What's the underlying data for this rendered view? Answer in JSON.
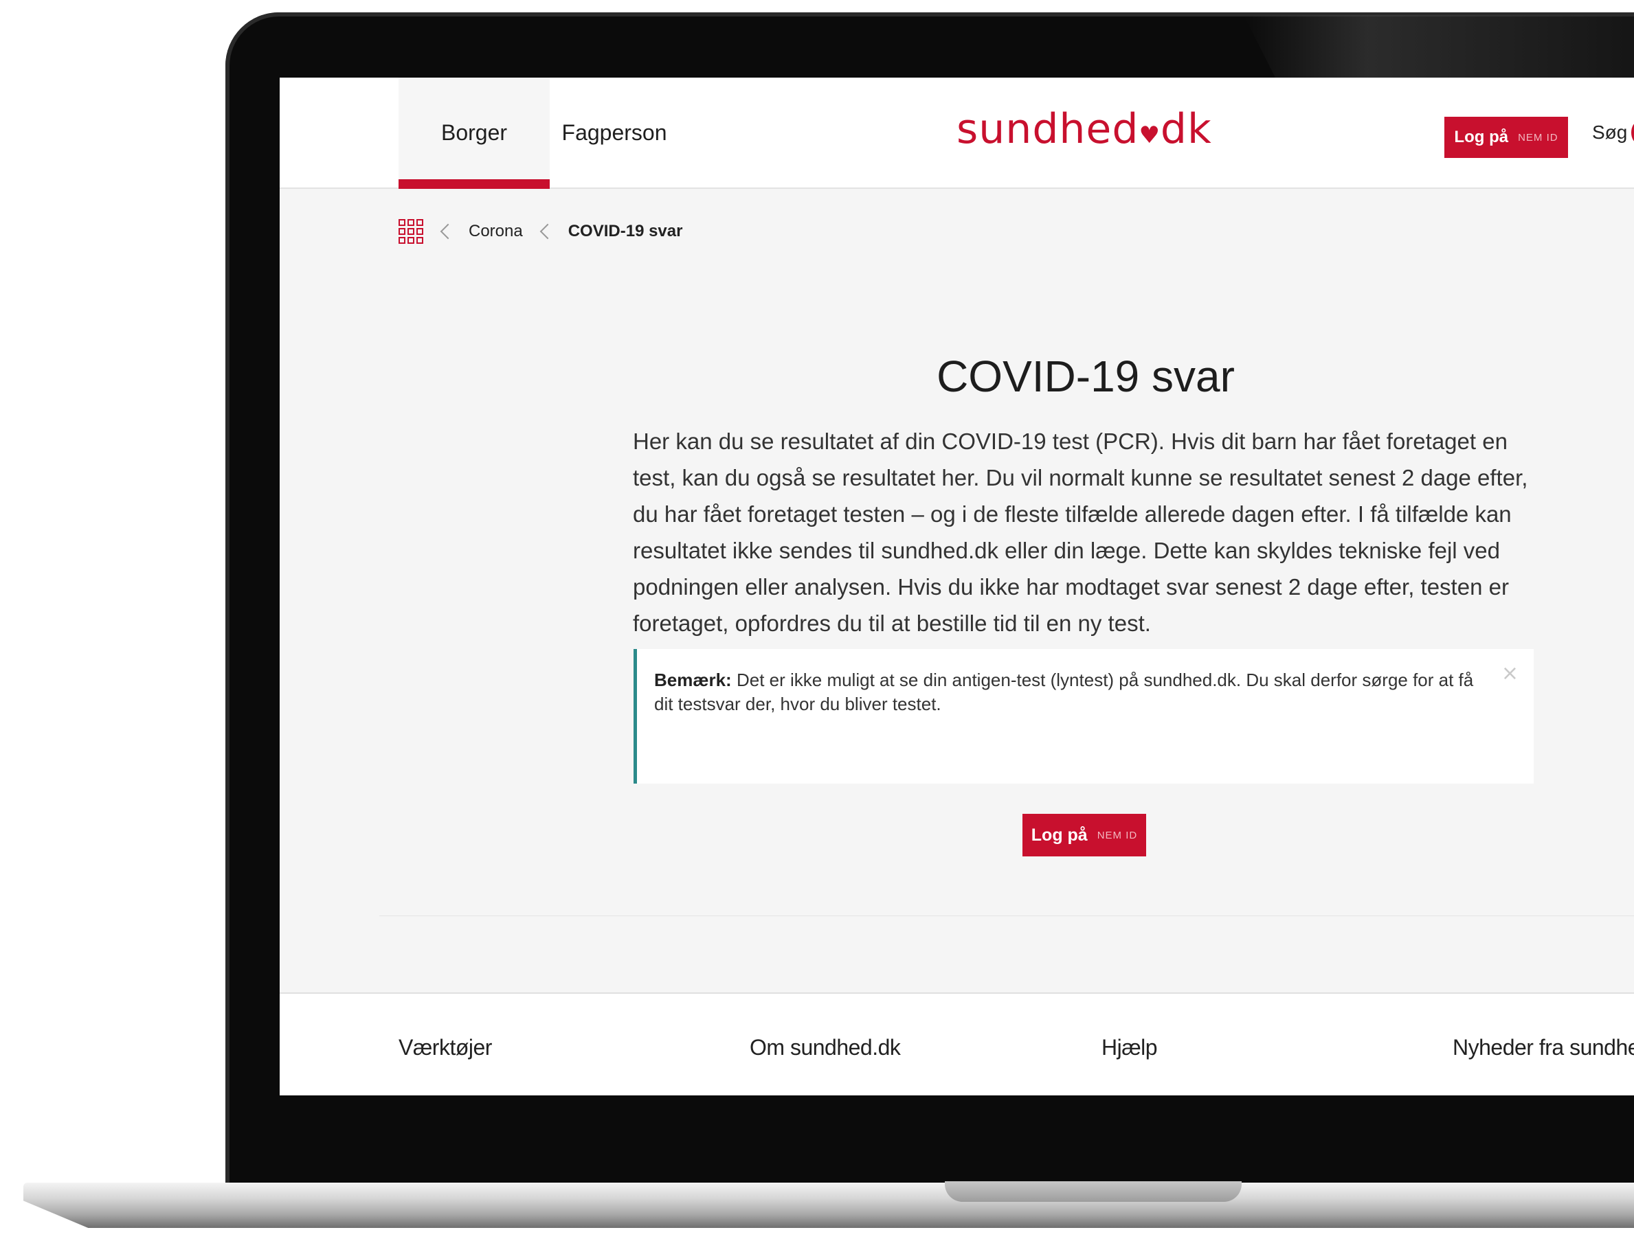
{
  "header": {
    "tabs": [
      {
        "label": "Borger",
        "active": true
      },
      {
        "label": "Fagperson",
        "active": false
      }
    ],
    "logo": {
      "text_left": "sundhed",
      "text_right": "dk"
    },
    "login": {
      "label": "Log på",
      "badge": "NEM ID"
    },
    "search_label": "Søg"
  },
  "breadcrumb": {
    "items": [
      "Corona",
      "COVID-19 svar"
    ]
  },
  "main": {
    "title": "COVID-19 svar",
    "intro": "Her kan du se resultatet af din COVID-19 test (PCR). Hvis dit barn har fået foretaget en test, kan du også se resultatet her. Du vil normalt kunne se resultatet senest 2 dage efter, du har fået foretaget testen – og i de fleste tilfælde allerede dagen efter. I få tilfælde kan resultatet ikke sendes til sundhed.dk eller din læge. Dette kan skyldes tekniske fejl ved podningen eller analysen. Hvis du ikke har modtaget svar senest 2 dage efter, testen er foretaget, opfordres du til at bestille tid til en ny test.",
    "notice": {
      "label": "Bemærk:",
      "text": "Det er ikke muligt at se din antigen-test (lyntest) på sundhed.dk. Du skal derfor sørge for at få dit testsvar der, hvor du bliver testet.",
      "close": "×"
    },
    "login": {
      "label": "Log på",
      "badge": "NEM ID"
    }
  },
  "footer": {
    "columns": [
      "Værktøjer",
      "Om sundhed.dk",
      "Hjælp",
      "Nyheder fra sundhed.dk"
    ]
  },
  "colors": {
    "brand_red": "#c8102e",
    "notice_accent": "#2b8a8a"
  }
}
